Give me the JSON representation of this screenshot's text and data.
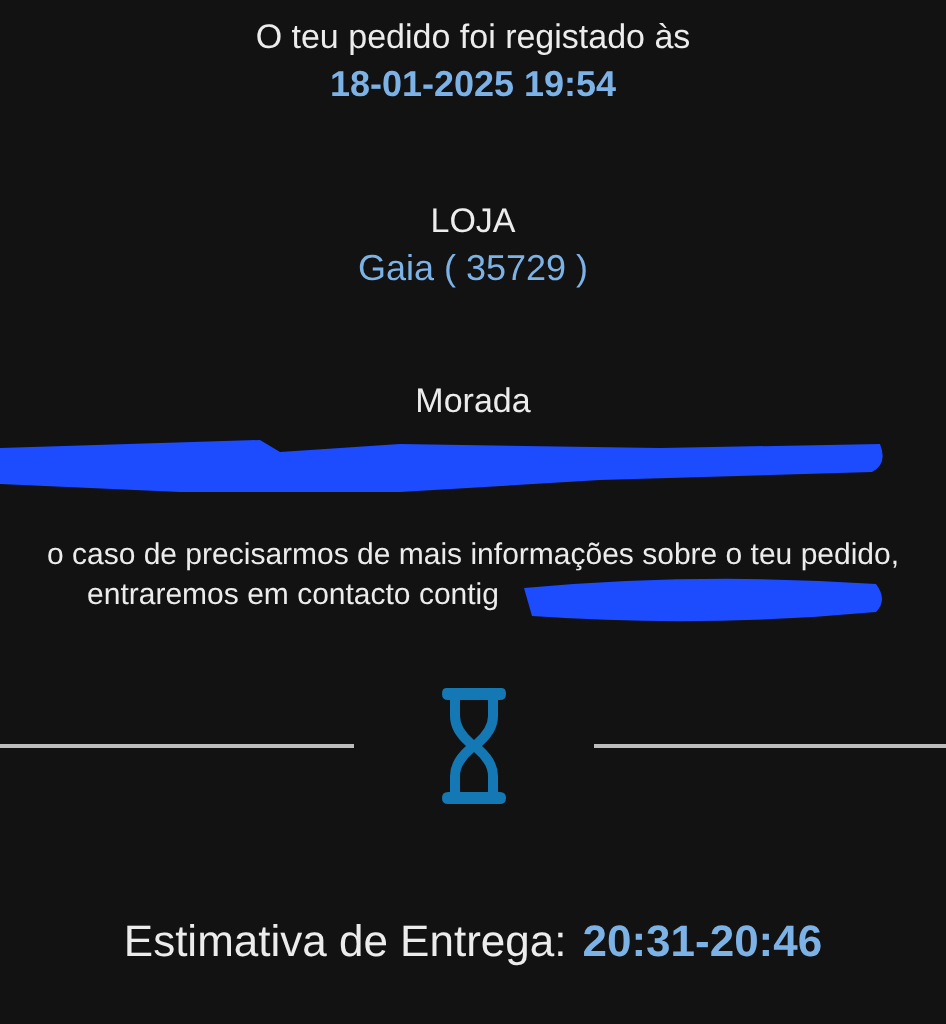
{
  "header": {
    "intro": "O teu pedido foi registado às",
    "datetime": "18-01-2025 19:54"
  },
  "store": {
    "label": "LOJA",
    "value": "Gaia ( 35729 )"
  },
  "address": {
    "label": "Morada",
    "redacted": true
  },
  "notice": {
    "lines": [
      "o caso de precisarmos de mais informações sobre o teu pedido,",
      "entraremos em contacto contig"
    ],
    "redacted": true
  },
  "estimate": {
    "label": "Estimativa de Entrega:",
    "value": "20:31-20:46"
  }
}
